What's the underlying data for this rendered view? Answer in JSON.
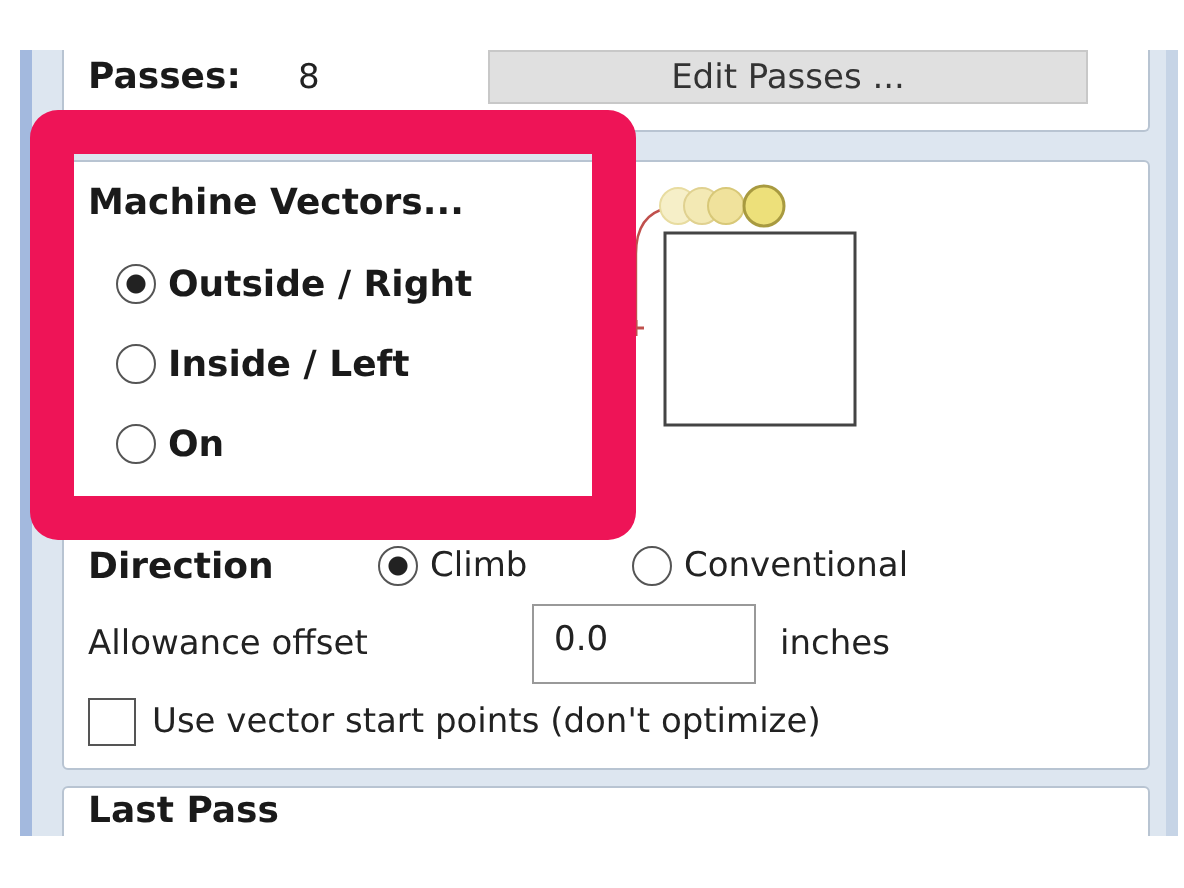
{
  "passes": {
    "label": "Passes:",
    "value": "8",
    "button": "Edit Passes ..."
  },
  "machine_vectors": {
    "heading": "Machine Vectors...",
    "options": [
      {
        "label": "Outside / Right",
        "selected": true
      },
      {
        "label": "Inside / Left",
        "selected": false
      },
      {
        "label": "On",
        "selected": false
      }
    ]
  },
  "direction": {
    "label": "Direction",
    "options": [
      {
        "label": "Climb",
        "selected": true
      },
      {
        "label": "Conventional",
        "selected": false
      }
    ]
  },
  "allowance": {
    "label": "Allowance offset",
    "value": "0.0",
    "unit": "inches"
  },
  "start_points": {
    "label": "Use vector start points (don't optimize)",
    "checked": false
  },
  "last_pass": {
    "heading": "Last Pass"
  }
}
